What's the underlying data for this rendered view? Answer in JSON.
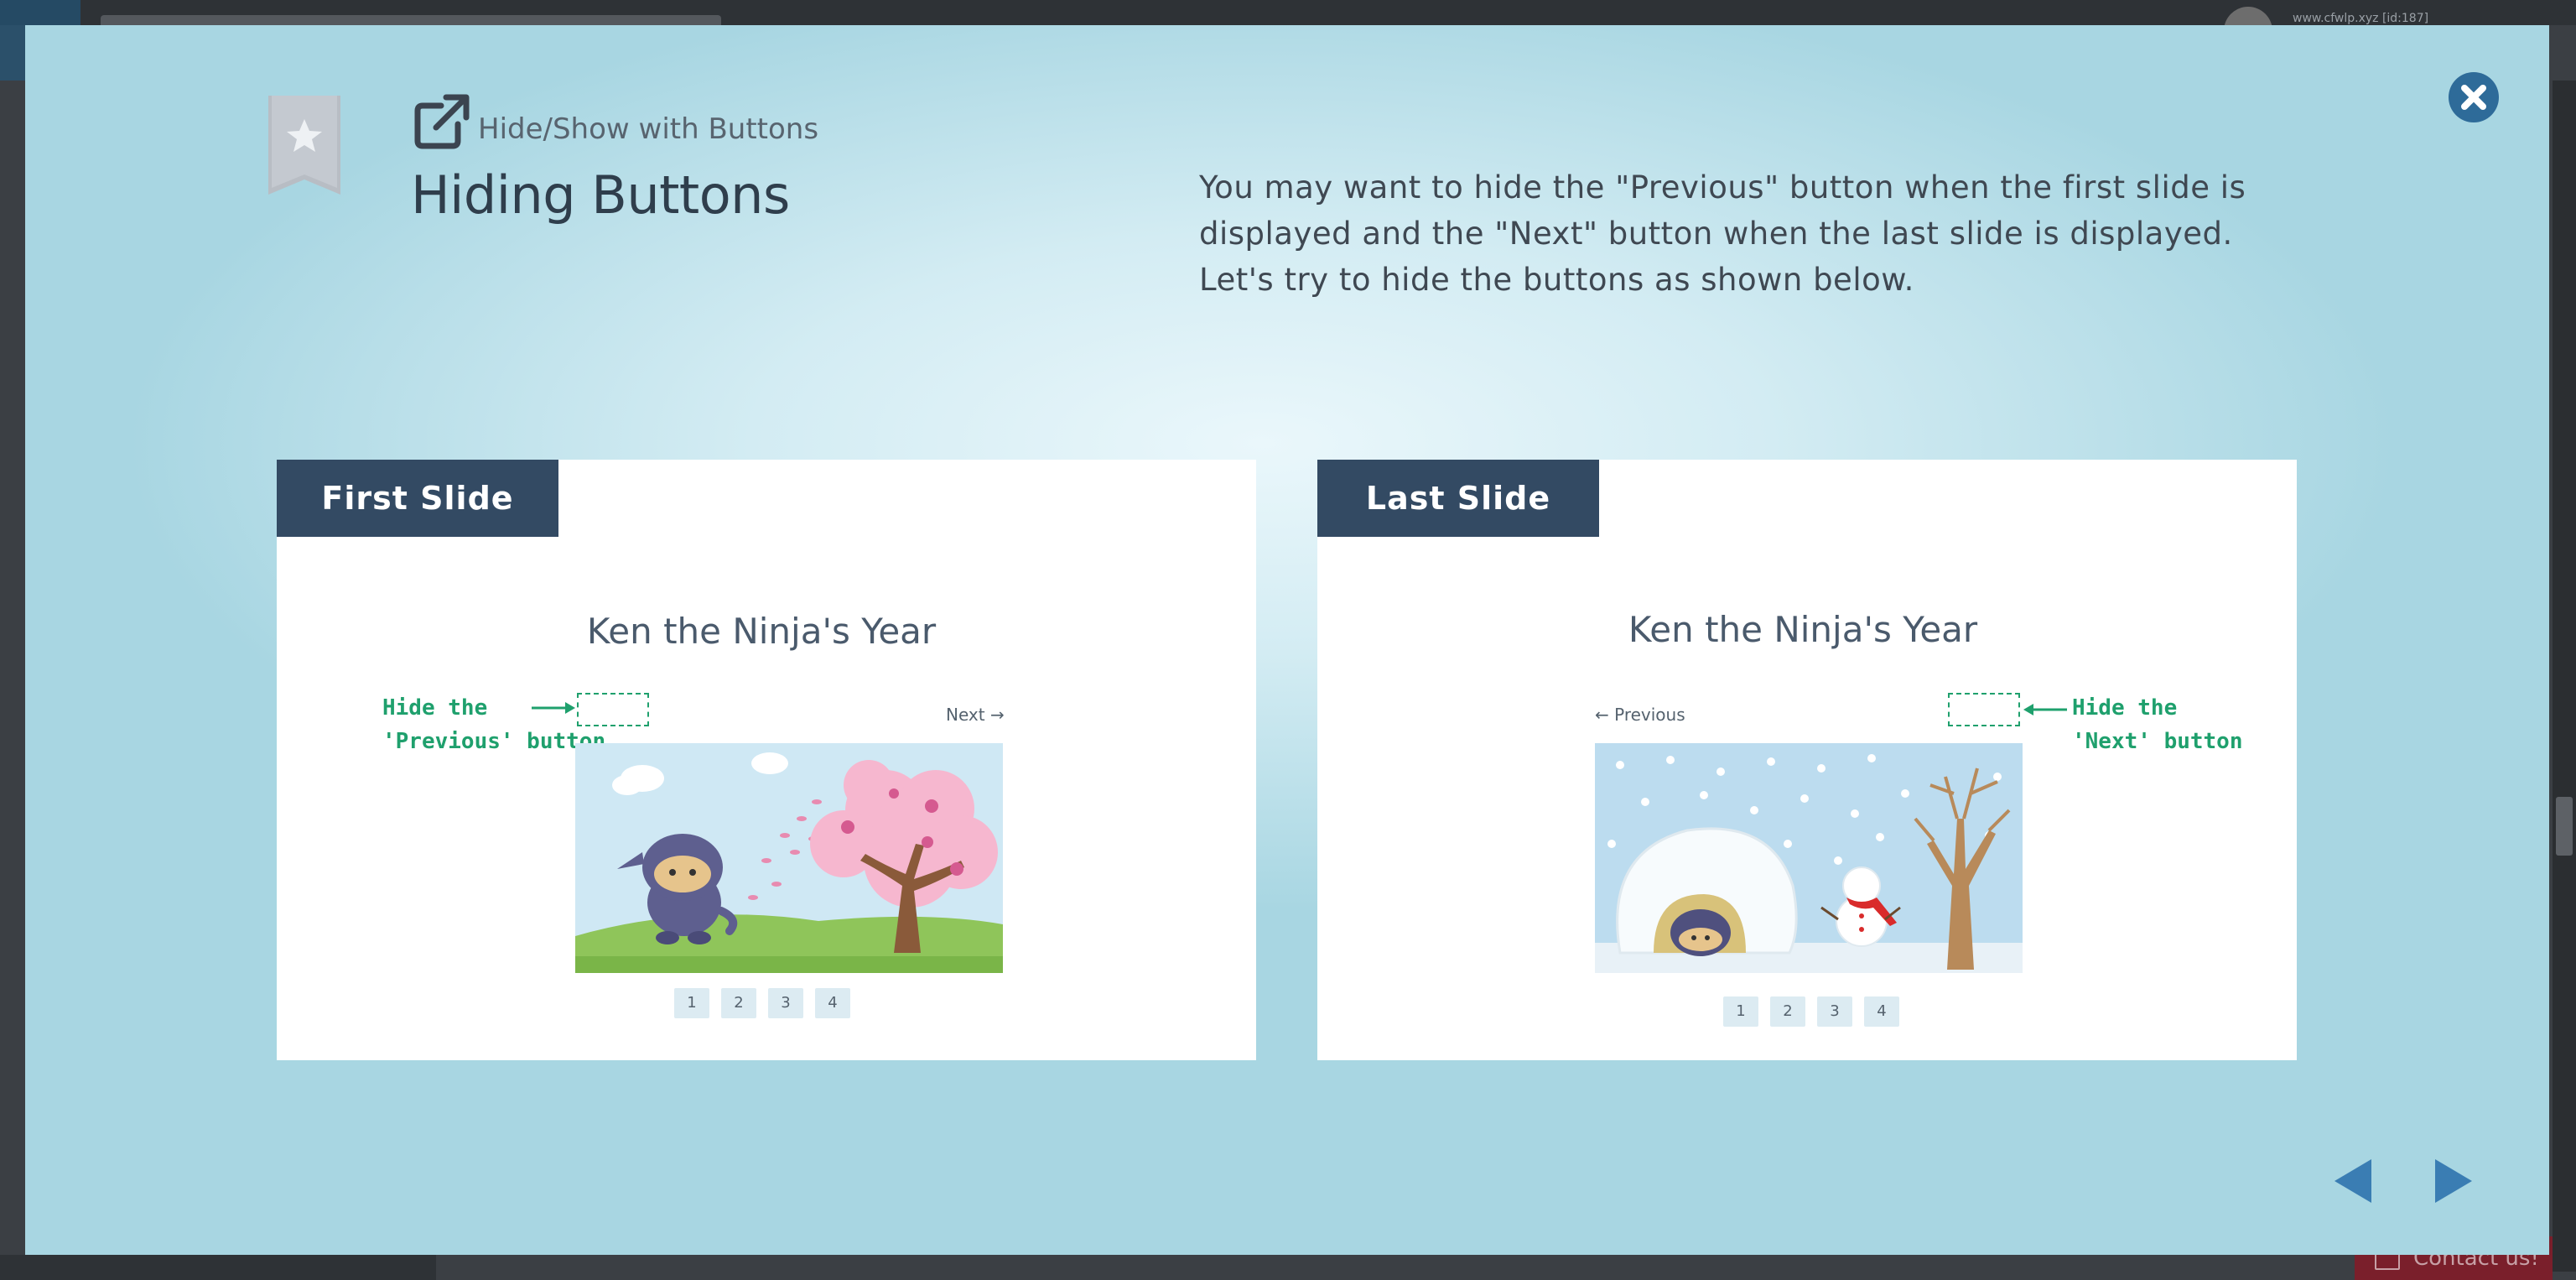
{
  "background": {
    "user_text": "www.cfwlp.xyz [id:187]",
    "contact_label": "Contact us!"
  },
  "modal": {
    "section_title": "Hide/Show with Buttons",
    "slide_title": "Hiding Buttons",
    "description": "You may want to hide the \"Previous\" button when the first slide is displayed and the \"Next\" button when the last slide is displayed. Let's try to hide the buttons as shown below.",
    "first_panel": {
      "tag": "First Slide",
      "heading": "Ken the Ninja's Year",
      "next_label": "Next →",
      "annotation": [
        "Hide the",
        "'Previous' button"
      ],
      "pages": [
        "1",
        "2",
        "3",
        "4"
      ]
    },
    "last_panel": {
      "tag": "Last Slide",
      "heading": "Ken the Ninja's Year",
      "prev_label": "← Previous",
      "annotation": [
        "Hide the",
        "'Next' button"
      ],
      "pages": [
        "1",
        "2",
        "3",
        "4"
      ]
    },
    "icons": {
      "bookmark": "bookmark-star-icon",
      "external": "external-link-icon",
      "close": "close-icon",
      "prev": "triangle-left-icon",
      "next": "triangle-right-icon"
    },
    "colors": {
      "tag_bg": "#334a63",
      "annotation": "#1fa06d",
      "close_bg": "#2e6b99",
      "arrow": "#3a7db3"
    }
  }
}
